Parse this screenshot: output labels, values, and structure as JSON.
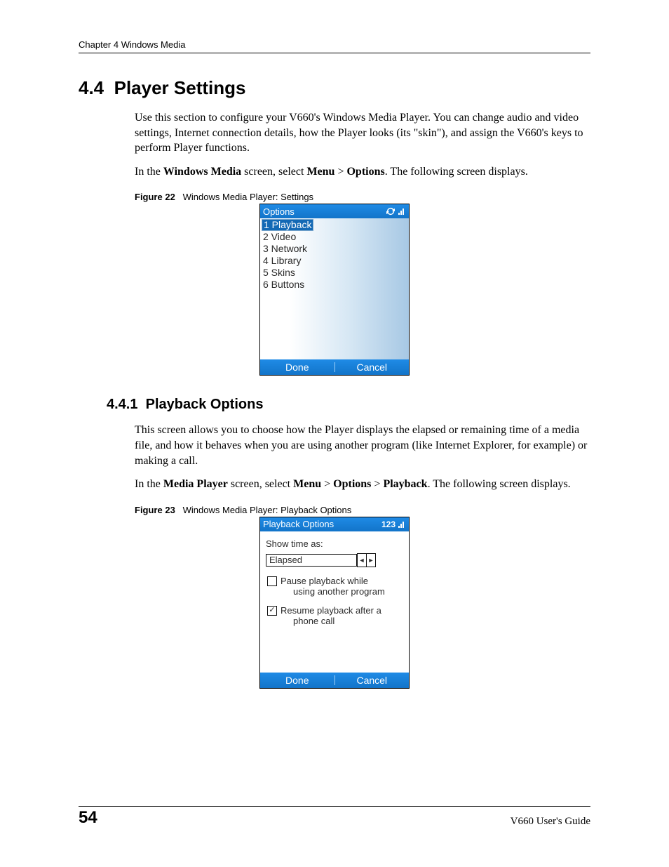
{
  "header": {
    "chapter": "Chapter 4 Windows Media"
  },
  "section": {
    "number": "4.4",
    "title": "Player Settings",
    "p1_a": "Use this section to configure your V660's Windows Media Player. You can change audio and video settings, Internet connection details, how the Player looks (its \"skin\"), and assign the V660's keys to perform Player functions.",
    "p2_a": "In the ",
    "p2_b": "Windows Media",
    "p2_c": " screen, select ",
    "p2_d": "Menu",
    "p2_e": " > ",
    "p2_f": "Options",
    "p2_g": ". The following screen displays."
  },
  "fig22": {
    "label": "Figure 22",
    "caption": "Windows Media Player: Settings",
    "titlebar": "Options",
    "items": [
      "1 Playback",
      "2 Video",
      "3 Network",
      "4 Library",
      "5 Skins",
      "6 Buttons"
    ],
    "done": "Done",
    "cancel": "Cancel"
  },
  "subsection": {
    "number": "4.4.1",
    "title": "Playback Options",
    "p1": "This screen allows you to choose how the Player displays the elapsed or remaining time of a media file, and how it behaves when you are using another program (like Internet Explorer, for example) or making a call.",
    "p2_a": "In the ",
    "p2_b": "Media Player",
    "p2_c": " screen, select ",
    "p2_d": "Menu",
    "p2_e": " > ",
    "p2_f": "Options",
    "p2_g": " > ",
    "p2_h": "Playback",
    "p2_i": ". The following screen displays."
  },
  "fig23": {
    "label": "Figure 23",
    "caption": "Windows Media Player: Playback Options",
    "titlebar": "Playback Options",
    "input_mode": "123",
    "show_label": "Show time as:",
    "show_value": "Elapsed",
    "chk1_a": "Pause playback while",
    "chk1_b": "using another program",
    "chk1_checked": false,
    "chk2_a": "Resume playback after a",
    "chk2_b": "phone call",
    "chk2_checked": true,
    "done": "Done",
    "cancel": "Cancel"
  },
  "footer": {
    "page": "54",
    "guide": "V660 User's Guide"
  }
}
